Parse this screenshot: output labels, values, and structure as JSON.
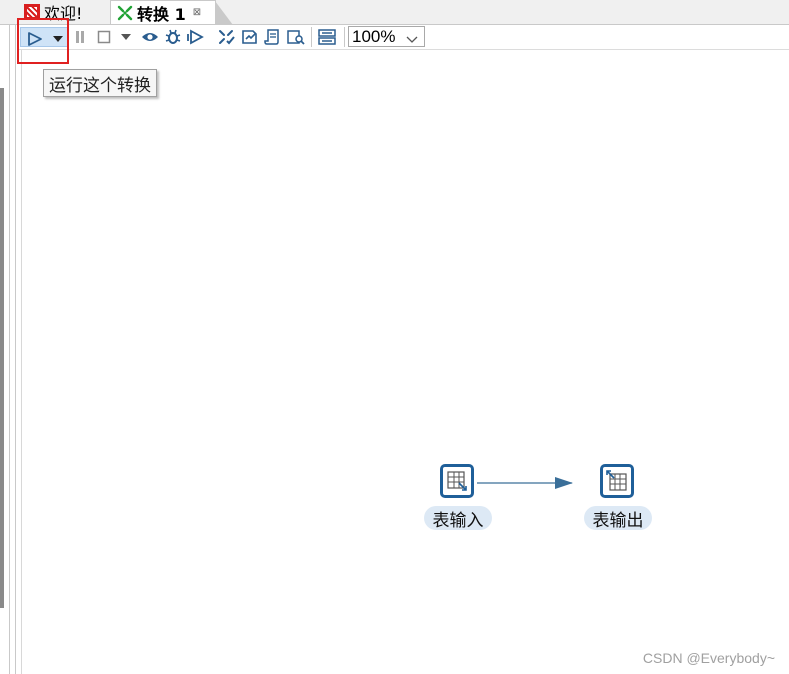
{
  "tabs": [
    {
      "label": "欢迎!",
      "icon": "welcome-icon"
    },
    {
      "label": "转换 1",
      "icon": "transform-icon",
      "close": "⊠"
    }
  ],
  "toolbar": {
    "zoom": "100%",
    "tooltip": "运行这个转换"
  },
  "steps": [
    {
      "label": "表输入",
      "icon": "table-input-icon"
    },
    {
      "label": "表输出",
      "icon": "table-output-icon"
    }
  ],
  "watermark": "CSDN @Everybody~",
  "colors": {
    "step_border": "#1f5f99",
    "step_label_bg": "#dde9f5",
    "hop_line": "#3a6f99",
    "highlight": "#e02020"
  }
}
